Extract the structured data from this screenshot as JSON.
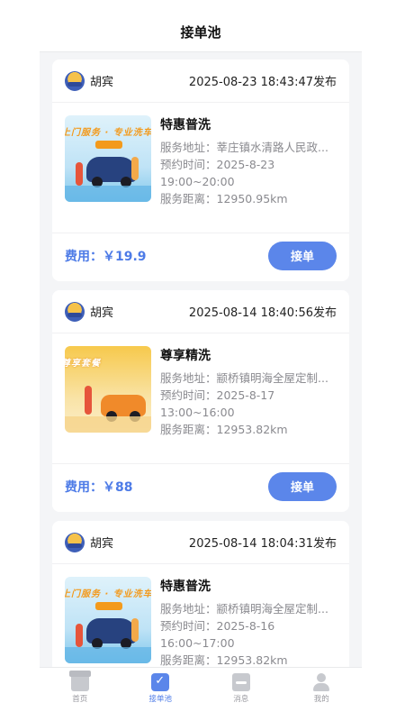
{
  "header": {
    "title": "接单池"
  },
  "orders": [
    {
      "user": "胡宾",
      "published": "2025-08-23 18:43:47发布",
      "service": "特惠普洗",
      "address": "服务地址：莘庄镇水清路人民政...",
      "time_label": "预约时间：2025-8-23",
      "time_slot": "19:00~20:00",
      "distance": "服务距离：12950.95km",
      "fee": "费用：￥19.9",
      "button": "接单",
      "thumb_text": "上门服务 · 专业洗车"
    },
    {
      "user": "胡宾",
      "published": "2025-08-14 18:40:56发布",
      "service": "尊享精洗",
      "address": "服务地址：颛桥镇明海全屋定制...",
      "time_label": "预约时间：2025-8-17",
      "time_slot": "13:00~16:00",
      "distance": "服务距离：12953.82km",
      "fee": "费用：￥88",
      "button": "接单",
      "thumb_text": "尊享套餐"
    },
    {
      "user": "胡宾",
      "published": "2025-08-14 18:04:31发布",
      "service": "特惠普洗",
      "address": "服务地址：颛桥镇明海全屋定制...",
      "time_label": "预约时间：2025-8-16",
      "time_slot": "16:00~17:00",
      "distance": "服务距离：12953.82km",
      "fee": "",
      "button": "",
      "thumb_text": "上门服务 · 专业洗车"
    }
  ],
  "tabbar": [
    {
      "label": "首页",
      "icon": "home-icon"
    },
    {
      "label": "接单池",
      "icon": "order-pool-icon",
      "active": true
    },
    {
      "label": "消息",
      "icon": "message-icon"
    },
    {
      "label": "我的",
      "icon": "profile-icon"
    }
  ],
  "colors": {
    "accent": "#5b86ea",
    "fee": "#4d7be7",
    "background": "#f4f5f7"
  }
}
